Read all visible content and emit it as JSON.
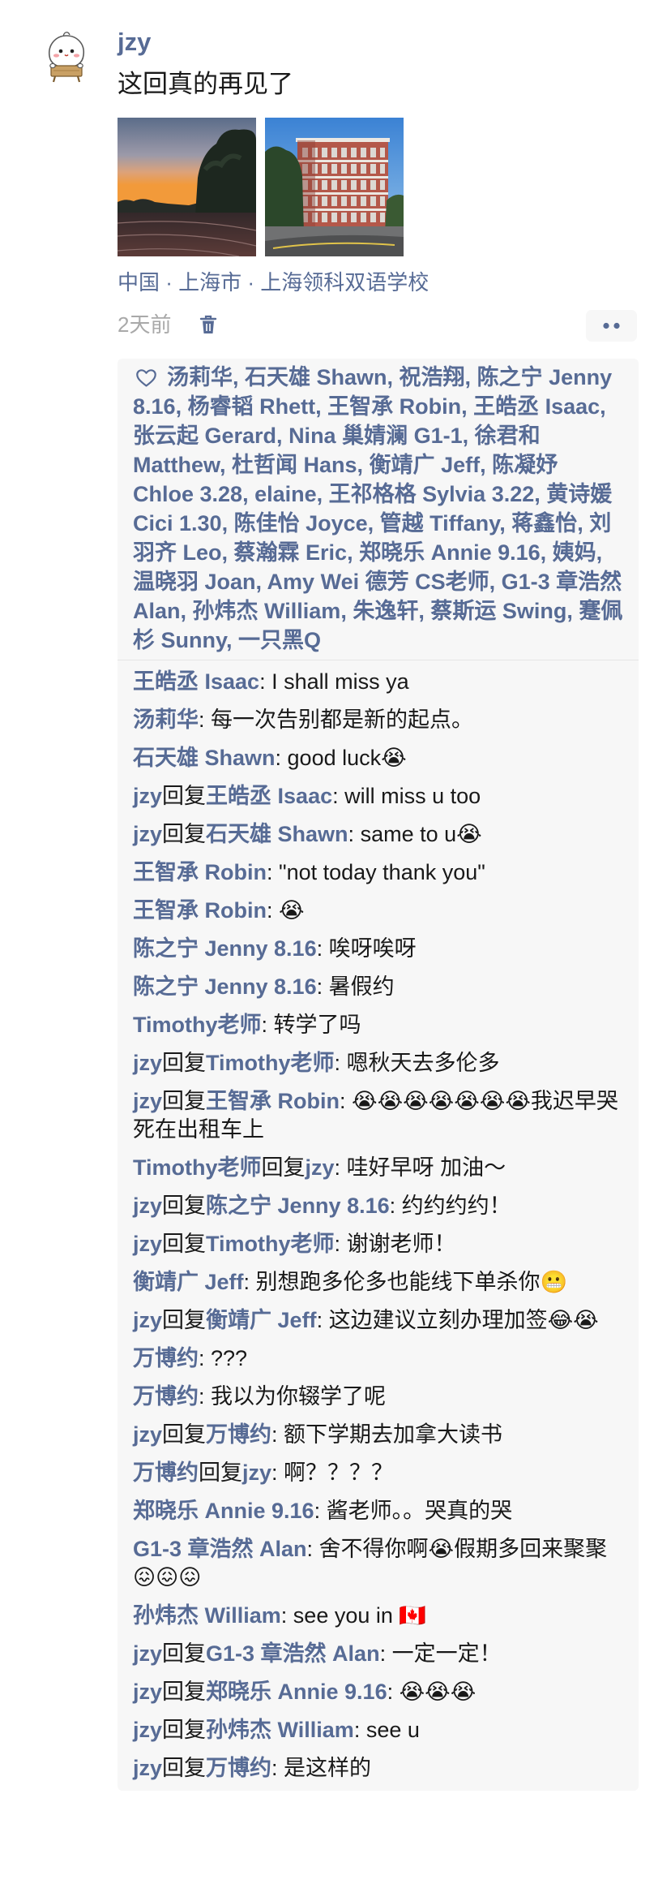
{
  "post": {
    "author": "jzy",
    "text": "这回真的再见了",
    "location": "中国 · 上海市 · 上海领科双语学校",
    "time": "2天前"
  },
  "icons": {
    "like": "heart-icon",
    "delete": "trash-icon",
    "more": "more-dots-icon"
  },
  "colors": {
    "link": "#576b95",
    "muted": "#a9a9a9",
    "panel": "#f7f7f7",
    "divider": "#e5e5e5",
    "text": "#191919"
  },
  "labels": {
    "reply": "回复",
    "comment_separator": ": ",
    "like_separator": ", "
  },
  "likes": [
    "汤莉华",
    "石天雄 Shawn",
    "祝浩翔",
    "陈之宁 Jenny 8.16",
    "杨睿韬 Rhett",
    "王智承 Robin",
    "王皓丞 Isaac",
    "张云起 Gerard",
    "Nina 巢婧澜 G1-1",
    "徐君和 Matthew",
    "杜哲闻 Hans",
    "衡靖广 Jeff",
    "陈凝妤 Chloe 3.28",
    "elaine",
    "王祁格格 Sylvia 3.22",
    "黄诗媛 Cici 1.30",
    "陈佳怡 Joyce",
    "管越 Tiffany",
    "蒋鑫怡",
    "刘羽齐 Leo",
    "蔡瀚霖 Eric",
    "郑晓乐 Annie 9.16",
    "姨妈",
    "温晓羽 Joan",
    "Amy Wei 德芳 CS老师",
    "G1-3 章浩然 Alan",
    "孙炜杰 William",
    "朱逸轩",
    "蔡斯运 Swing",
    "蹇佩杉 Sunny",
    "一只黑Q"
  ],
  "comments": [
    {
      "from": "王皓丞 Isaac",
      "text": "I shall miss ya"
    },
    {
      "from": "汤莉华",
      "text": "每一次告别都是新的起点。"
    },
    {
      "from": "石天雄 Shawn",
      "text": "good luck😭"
    },
    {
      "from": "jzy",
      "to": "王皓丞 Isaac",
      "text": "will miss u too"
    },
    {
      "from": "jzy",
      "to": "石天雄 Shawn",
      "text": "same to u😭"
    },
    {
      "from": "王智承 Robin",
      "text": "\"not today thank you\""
    },
    {
      "from": "王智承 Robin",
      "text": "😭"
    },
    {
      "from": "陈之宁 Jenny 8.16",
      "text": "唉呀唉呀"
    },
    {
      "from": "陈之宁 Jenny 8.16",
      "text": "暑假约"
    },
    {
      "from": "Timothy老师",
      "text": "转学了吗"
    },
    {
      "from": "jzy",
      "to": "Timothy老师",
      "text": "嗯秋天去多伦多"
    },
    {
      "from": "jzy",
      "to": "王智承 Robin",
      "text": "😭😭😭😭😭😭😭我迟早哭死在出租车上"
    },
    {
      "from": "Timothy老师",
      "to": "jzy",
      "text": "哇好早呀 加油～"
    },
    {
      "from": "jzy",
      "to": "陈之宁 Jenny 8.16",
      "text": "约约约约！"
    },
    {
      "from": "jzy",
      "to": "Timothy老师",
      "text": "谢谢老师！"
    },
    {
      "from": "衡靖广 Jeff",
      "text": "别想跑多伦多也能线下单杀你😬"
    },
    {
      "from": "jzy",
      "to": "衡靖广 Jeff",
      "text": "这边建议立刻办理加签😂😭"
    },
    {
      "from": "万博约",
      "text": "???"
    },
    {
      "from": "万博约",
      "text": "我以为你辍学了呢"
    },
    {
      "from": "jzy",
      "to": "万博约",
      "text": "额下学期去加拿大读书"
    },
    {
      "from": "万博约",
      "to": "jzy",
      "text": "啊？？？？"
    },
    {
      "from": "郑晓乐 Annie 9.16",
      "text": "酱老师。。哭真的哭"
    },
    {
      "from": "G1-3 章浩然 Alan",
      "text": "舍不得你啊😭假期多回来聚聚😖😖😖"
    },
    {
      "from": "孙炜杰 William",
      "text": "see you in 🇨🇦"
    },
    {
      "from": "jzy",
      "to": "G1-3 章浩然 Alan",
      "text": "一定一定！"
    },
    {
      "from": "jzy",
      "to": "郑晓乐 Annie 9.16",
      "text": "😭😭😭"
    },
    {
      "from": "jzy",
      "to": "孙炜杰 William",
      "text": "see u"
    },
    {
      "from": "jzy",
      "to": "万博约",
      "text": "是这样的"
    }
  ]
}
